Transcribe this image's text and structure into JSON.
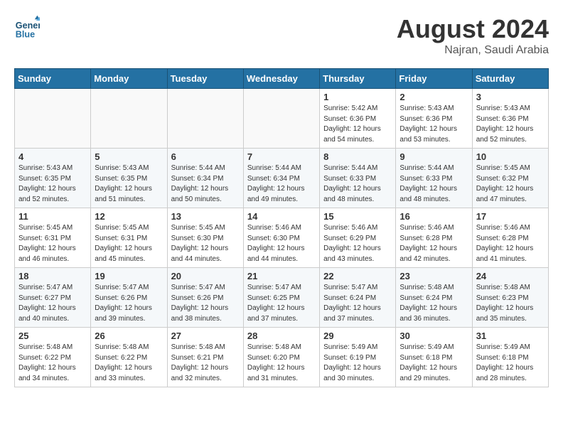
{
  "header": {
    "logo_line1": "General",
    "logo_line2": "Blue",
    "title": "August 2024",
    "subtitle": "Najran, Saudi Arabia"
  },
  "days_of_week": [
    "Sunday",
    "Monday",
    "Tuesday",
    "Wednesday",
    "Thursday",
    "Friday",
    "Saturday"
  ],
  "weeks": [
    [
      {
        "day": "",
        "info": ""
      },
      {
        "day": "",
        "info": ""
      },
      {
        "day": "",
        "info": ""
      },
      {
        "day": "",
        "info": ""
      },
      {
        "day": "1",
        "info": "Sunrise: 5:42 AM\nSunset: 6:36 PM\nDaylight: 12 hours\nand 54 minutes."
      },
      {
        "day": "2",
        "info": "Sunrise: 5:43 AM\nSunset: 6:36 PM\nDaylight: 12 hours\nand 53 minutes."
      },
      {
        "day": "3",
        "info": "Sunrise: 5:43 AM\nSunset: 6:36 PM\nDaylight: 12 hours\nand 52 minutes."
      }
    ],
    [
      {
        "day": "4",
        "info": "Sunrise: 5:43 AM\nSunset: 6:35 PM\nDaylight: 12 hours\nand 52 minutes."
      },
      {
        "day": "5",
        "info": "Sunrise: 5:43 AM\nSunset: 6:35 PM\nDaylight: 12 hours\nand 51 minutes."
      },
      {
        "day": "6",
        "info": "Sunrise: 5:44 AM\nSunset: 6:34 PM\nDaylight: 12 hours\nand 50 minutes."
      },
      {
        "day": "7",
        "info": "Sunrise: 5:44 AM\nSunset: 6:34 PM\nDaylight: 12 hours\nand 49 minutes."
      },
      {
        "day": "8",
        "info": "Sunrise: 5:44 AM\nSunset: 6:33 PM\nDaylight: 12 hours\nand 48 minutes."
      },
      {
        "day": "9",
        "info": "Sunrise: 5:44 AM\nSunset: 6:33 PM\nDaylight: 12 hours\nand 48 minutes."
      },
      {
        "day": "10",
        "info": "Sunrise: 5:45 AM\nSunset: 6:32 PM\nDaylight: 12 hours\nand 47 minutes."
      }
    ],
    [
      {
        "day": "11",
        "info": "Sunrise: 5:45 AM\nSunset: 6:31 PM\nDaylight: 12 hours\nand 46 minutes."
      },
      {
        "day": "12",
        "info": "Sunrise: 5:45 AM\nSunset: 6:31 PM\nDaylight: 12 hours\nand 45 minutes."
      },
      {
        "day": "13",
        "info": "Sunrise: 5:45 AM\nSunset: 6:30 PM\nDaylight: 12 hours\nand 44 minutes."
      },
      {
        "day": "14",
        "info": "Sunrise: 5:46 AM\nSunset: 6:30 PM\nDaylight: 12 hours\nand 44 minutes."
      },
      {
        "day": "15",
        "info": "Sunrise: 5:46 AM\nSunset: 6:29 PM\nDaylight: 12 hours\nand 43 minutes."
      },
      {
        "day": "16",
        "info": "Sunrise: 5:46 AM\nSunset: 6:28 PM\nDaylight: 12 hours\nand 42 minutes."
      },
      {
        "day": "17",
        "info": "Sunrise: 5:46 AM\nSunset: 6:28 PM\nDaylight: 12 hours\nand 41 minutes."
      }
    ],
    [
      {
        "day": "18",
        "info": "Sunrise: 5:47 AM\nSunset: 6:27 PM\nDaylight: 12 hours\nand 40 minutes."
      },
      {
        "day": "19",
        "info": "Sunrise: 5:47 AM\nSunset: 6:26 PM\nDaylight: 12 hours\nand 39 minutes."
      },
      {
        "day": "20",
        "info": "Sunrise: 5:47 AM\nSunset: 6:26 PM\nDaylight: 12 hours\nand 38 minutes."
      },
      {
        "day": "21",
        "info": "Sunrise: 5:47 AM\nSunset: 6:25 PM\nDaylight: 12 hours\nand 37 minutes."
      },
      {
        "day": "22",
        "info": "Sunrise: 5:47 AM\nSunset: 6:24 PM\nDaylight: 12 hours\nand 37 minutes."
      },
      {
        "day": "23",
        "info": "Sunrise: 5:48 AM\nSunset: 6:24 PM\nDaylight: 12 hours\nand 36 minutes."
      },
      {
        "day": "24",
        "info": "Sunrise: 5:48 AM\nSunset: 6:23 PM\nDaylight: 12 hours\nand 35 minutes."
      }
    ],
    [
      {
        "day": "25",
        "info": "Sunrise: 5:48 AM\nSunset: 6:22 PM\nDaylight: 12 hours\nand 34 minutes."
      },
      {
        "day": "26",
        "info": "Sunrise: 5:48 AM\nSunset: 6:22 PM\nDaylight: 12 hours\nand 33 minutes."
      },
      {
        "day": "27",
        "info": "Sunrise: 5:48 AM\nSunset: 6:21 PM\nDaylight: 12 hours\nand 32 minutes."
      },
      {
        "day": "28",
        "info": "Sunrise: 5:48 AM\nSunset: 6:20 PM\nDaylight: 12 hours\nand 31 minutes."
      },
      {
        "day": "29",
        "info": "Sunrise: 5:49 AM\nSunset: 6:19 PM\nDaylight: 12 hours\nand 30 minutes."
      },
      {
        "day": "30",
        "info": "Sunrise: 5:49 AM\nSunset: 6:18 PM\nDaylight: 12 hours\nand 29 minutes."
      },
      {
        "day": "31",
        "info": "Sunrise: 5:49 AM\nSunset: 6:18 PM\nDaylight: 12 hours\nand 28 minutes."
      }
    ]
  ]
}
